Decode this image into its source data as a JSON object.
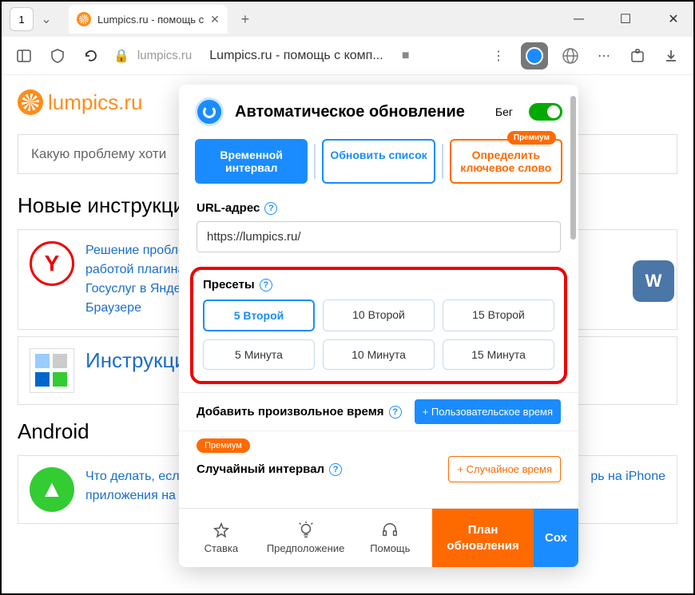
{
  "window": {
    "tab_number": "1",
    "tab_title": "Lumpics.ru - помощь с",
    "domain": "lumpics.ru",
    "page_title": "Lumpics.ru - помощь с комп..."
  },
  "site": {
    "logo": "lumpics.ru",
    "search_placeholder": "Какую проблему хоти",
    "new_instructions_heading": "Новые инструкции",
    "article1": "Решение проблем с работой плагина Госуслуг в Яндекс Браузере",
    "instructions_title": "Инструкции",
    "android_heading": "Android",
    "article2": "Что делать, если приложения на",
    "article2_right": "рь на iPhone"
  },
  "popup": {
    "title": "Автоматическое обновление",
    "run_label": "Бег",
    "tabs": {
      "t1": "Временной интервал",
      "t2": "Обновить список",
      "t3": "Определить ключевое слово",
      "premium": "Премиум"
    },
    "url_label": "URL-адрес",
    "url_value": "https://lumpics.ru/",
    "presets_label": "Пресеты",
    "presets": [
      "5 Второй",
      "10 Второй",
      "15 Второй",
      "5 Минута",
      "10 Минута",
      "15 Минута"
    ],
    "custom_label": "Добавить произвольное время",
    "custom_button": "+ Пользовательское время",
    "random_premium": "Премиум",
    "random_label": "Случайный интервал",
    "random_button": "+ Случайное время",
    "footer": {
      "rate": "Ставка",
      "suggest": "Предположение",
      "help": "Помощь",
      "plan": "План обновления",
      "save": "Сох"
    }
  }
}
